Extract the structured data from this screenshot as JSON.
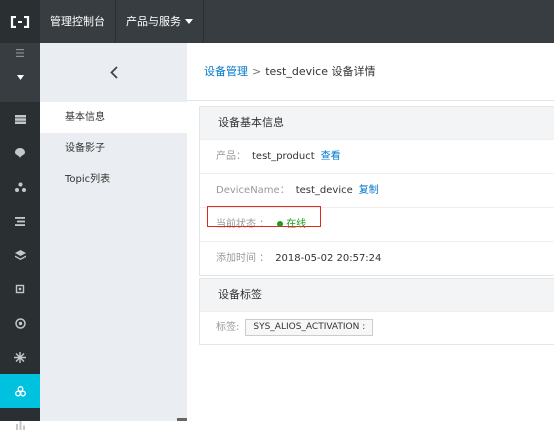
{
  "topbar": {
    "console_label": "管理控制台",
    "products_label": "产品与服务"
  },
  "rail": {
    "items": [
      "grid-icon",
      "bulb-icon",
      "cluster-icon",
      "list-icon",
      "layers-icon",
      "chip-icon",
      "target-icon",
      "asterisk-icon",
      "iot-icon",
      "chart-icon"
    ],
    "active_index": 8,
    "active_color": "#00c1de"
  },
  "subnav": {
    "items": [
      "基本信息",
      "设备影子",
      "Topic列表"
    ],
    "active_index": 0
  },
  "breadcrumb": {
    "parent": "设备管理",
    "separator": ">",
    "current": "test_device 设备详情"
  },
  "basic_info": {
    "title": "设备基本信息",
    "product_label": "产品：",
    "product_value": "test_product",
    "product_link": "查看",
    "device_name_label": "DeviceName：",
    "device_name_value": "test_device",
    "device_name_link": "复制",
    "status_label": "当前状态 ：",
    "status_value": "在线",
    "added_label": "添加时间 ：",
    "added_value": "2018-05-02 20:57:24"
  },
  "tags": {
    "title": "设备标签",
    "label": "标签:",
    "tag_value": "SYS_ALIOS_ACTIVATION :"
  }
}
